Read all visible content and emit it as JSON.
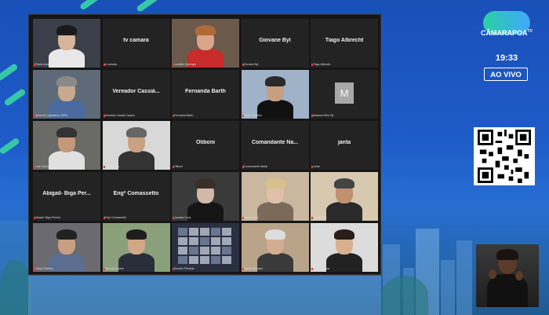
{
  "broadcast": {
    "logo_text": "CÂMARAPOA",
    "logo_sup": "TV",
    "time": "19:33",
    "live_label": "AO VIVO"
  },
  "colors": {
    "accent": "#36c7a8",
    "background": "#1e5cc9",
    "tile": "#232323"
  },
  "participants": [
    {
      "id": "p1",
      "display": "",
      "caption": "Paula Ivanic",
      "video": true
    },
    {
      "id": "p2",
      "display": "tv camara",
      "caption": "tv camara",
      "video": false
    },
    {
      "id": "p3",
      "display": "",
      "caption": "Lourdes Sprenger",
      "video": true
    },
    {
      "id": "p4",
      "display": "Giovane Byl",
      "caption": "Giovane Byl",
      "video": false
    },
    {
      "id": "p5",
      "display": "Tiago Albrecht",
      "caption": "Tiago Albrecht",
      "video": false
    },
    {
      "id": "p6",
      "display": "",
      "caption": "Diretoria Legislativa CMPA",
      "video": true
    },
    {
      "id": "p7",
      "display": "Vereador Cassiá...",
      "caption": "Vereador Cassiá Carpes",
      "video": false
    },
    {
      "id": "p8",
      "display": "Fernanda Barth",
      "caption": "Fernanda Barth",
      "video": false
    },
    {
      "id": "p9",
      "display": "",
      "caption": "Idenir Cecchim",
      "video": true
    },
    {
      "id": "p10",
      "display": "M",
      "caption": "Mariana Reis Sly",
      "video": false
    },
    {
      "id": "p11",
      "display": "",
      "caption": "Luiz Carlos Vaz",
      "video": true
    },
    {
      "id": "p12",
      "display": "",
      "caption": "Pedro Ruas",
      "video": true
    },
    {
      "id": "p13",
      "display": "Oliboni",
      "caption": "Oliboni",
      "video": false
    },
    {
      "id": "p14",
      "display": "Comandante Na...",
      "caption": "Comandante Nádia",
      "video": false
    },
    {
      "id": "p15",
      "display": "janta",
      "caption": "Janta",
      "video": false
    },
    {
      "id": "p16",
      "display": "Abigail- Biga Per...",
      "caption": "Abigail- Biga Pereira",
      "video": false
    },
    {
      "id": "p17",
      "display": "Engª Comassetto",
      "caption": "Engº Comassetto",
      "video": false
    },
    {
      "id": "p18",
      "display": "",
      "caption": "Jussara Cony",
      "video": true
    },
    {
      "id": "p19",
      "display": "",
      "caption": "Mônica Leal",
      "video": true
    },
    {
      "id": "p20",
      "display": "",
      "caption": "Jonas Reis",
      "video": true
    },
    {
      "id": "p21",
      "display": "",
      "caption": "Gilson Padeiro",
      "video": true
    },
    {
      "id": "p22",
      "display": "",
      "caption": "Ricardo Gomes",
      "video": true
    },
    {
      "id": "p23",
      "display": "",
      "caption": "Sessão Plenária",
      "video": true
    },
    {
      "id": "p24",
      "display": "",
      "caption": "Ramiro Rosário",
      "video": true
    },
    {
      "id": "p25",
      "display": "",
      "caption": "Karen Santos",
      "video": true
    }
  ]
}
